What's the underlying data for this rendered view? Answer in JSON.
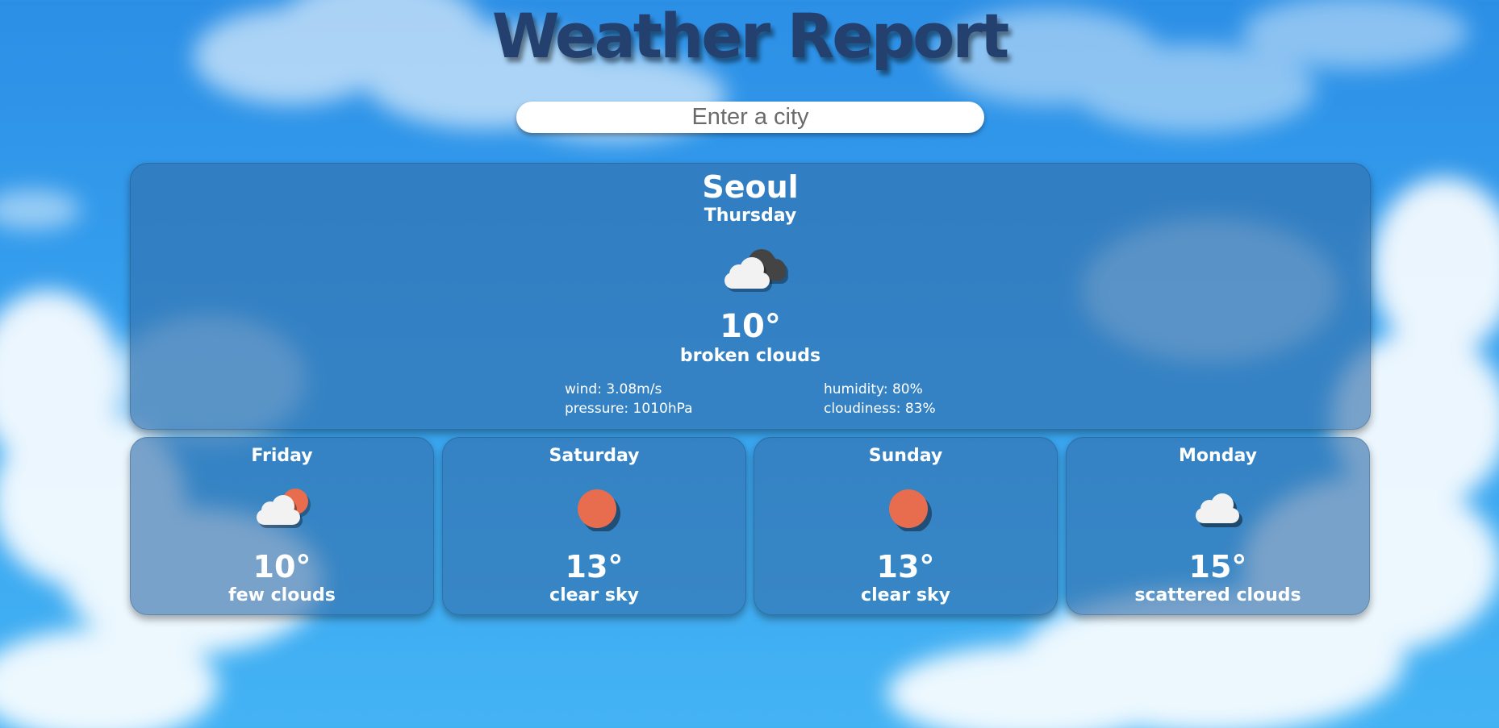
{
  "app": {
    "title": "Weather Report"
  },
  "search": {
    "placeholder": "Enter a city",
    "value": ""
  },
  "current": {
    "city": "Seoul",
    "day": "Thursday",
    "icon": "broken-clouds-icon",
    "temp": "10°",
    "description": "broken clouds",
    "wind": "wind: 3.08m/s",
    "pressure": "pressure: 1010hPa",
    "humidity": "humidity: 80%",
    "cloudiness": "cloudiness: 83%"
  },
  "forecast": [
    {
      "day": "Friday",
      "icon": "few-clouds-icon",
      "temp": "10°",
      "description": "few clouds"
    },
    {
      "day": "Saturday",
      "icon": "clear-sky-icon",
      "temp": "13°",
      "description": "clear sky"
    },
    {
      "day": "Sunday",
      "icon": "clear-sky-icon",
      "temp": "13°",
      "description": "clear sky"
    },
    {
      "day": "Monday",
      "icon": "scattered-clouds-icon",
      "temp": "15°",
      "description": "scattered clouds"
    }
  ],
  "colors": {
    "sky": "#36a0ee",
    "title": "#24406f",
    "panel": "#326eaa",
    "sun": "#e86d4f",
    "cloud": "#f2f2f2",
    "dark_cloud": "#444444"
  }
}
